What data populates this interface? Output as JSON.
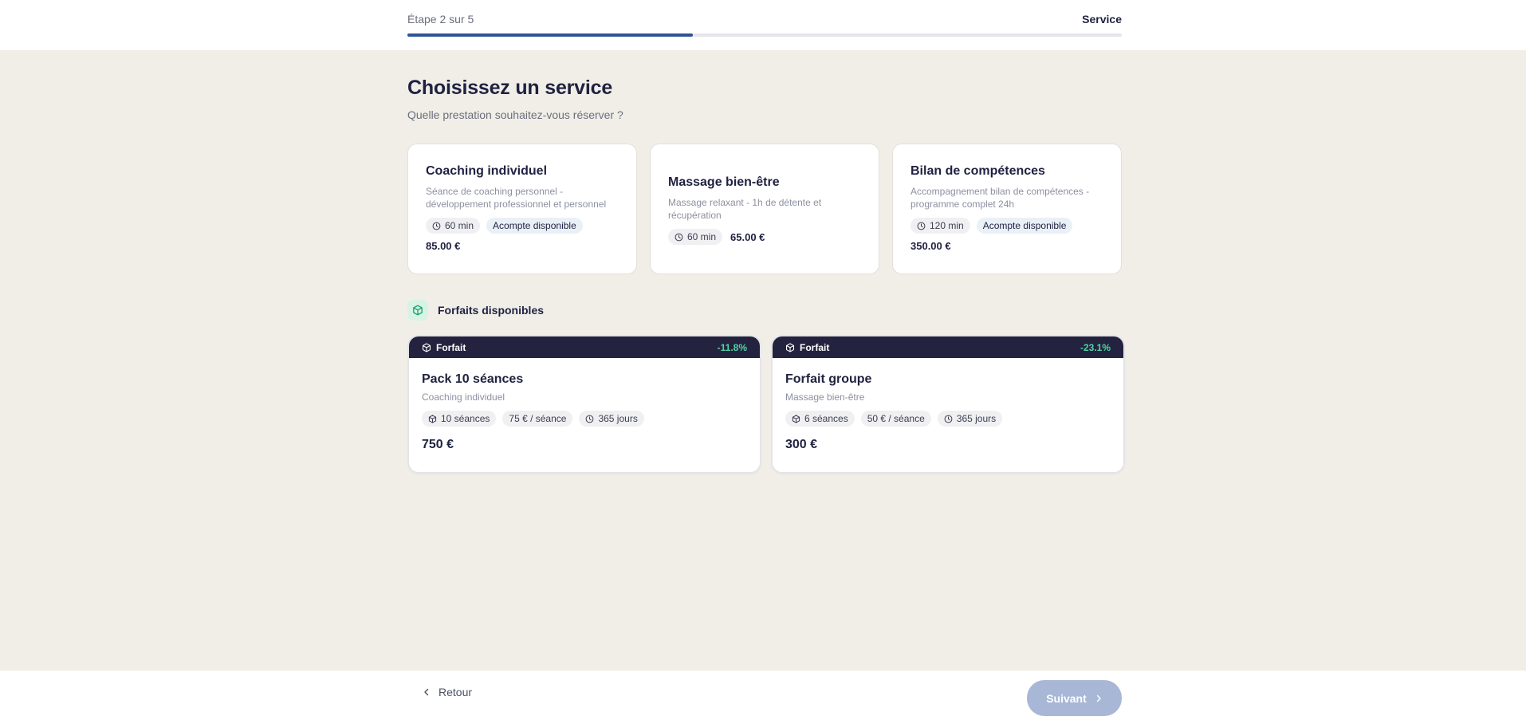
{
  "progress": {
    "step_label": "Étape 2 sur 5",
    "step_name": "Service",
    "current_step": 2,
    "total_steps": 5,
    "fraction": 0.4
  },
  "page": {
    "title": "Choisissez un service",
    "subtitle": "Quelle prestation souhaitez-vous réserver ?"
  },
  "services": [
    {
      "name": "Coaching individuel",
      "description": "Séance de coaching personnel - développement professionnel et personnel",
      "duration": "60 min",
      "badge": "Acompte disponible",
      "price": "85.00 €"
    },
    {
      "name": "Massage bien-être",
      "description": "Massage relaxant - 1h de détente et récupération",
      "duration": "60 min",
      "price": "65.00 €"
    },
    {
      "name": "Bilan de compétences",
      "description": "Accompagnement bilan de compétences - programme complet 24h",
      "duration": "120 min",
      "badge": "Acompte disponible",
      "price": "350.00 €"
    }
  ],
  "packages_section": {
    "title": "Forfaits disponibles",
    "icon": "package-icon"
  },
  "packages": [
    {
      "band_label": "Forfait",
      "discount": "-11.8%",
      "name": "Pack 10 séances",
      "service": "Coaching individuel",
      "sessions": "10 séances",
      "per_session": "75 € / séance",
      "validity": "365 jours",
      "price": "750 €"
    },
    {
      "band_label": "Forfait",
      "discount": "-23.1%",
      "name": "Forfait groupe",
      "service": "Massage bien-être",
      "sessions": "6 séances",
      "per_session": "50 € / séance",
      "validity": "365 jours",
      "price": "300 €"
    }
  ],
  "footer": {
    "back_label": "Retour",
    "next_label": "Suivant"
  },
  "colors": {
    "progress": "#2f5496",
    "band": "#23223f",
    "discount": "#4ed6a1",
    "next_disabled": "#a8b7d6",
    "background": "#f1eee8"
  }
}
